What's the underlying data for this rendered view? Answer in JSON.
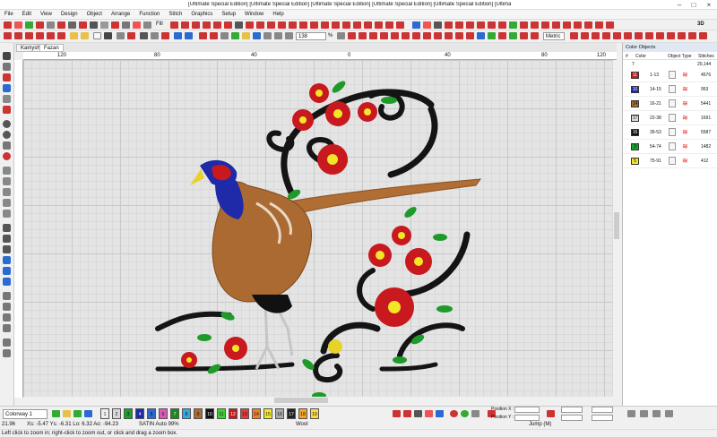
{
  "title": "[Ultimate Special Edition] [Ultimate Special Edition] [Ultimate Special Edition] [Ultimate Special Edition] [Ultimate Special Edition] [Ultimate Special Edition] [Ultimate Special Edit]",
  "menu": [
    "File",
    "Edit",
    "View",
    "Design",
    "Object",
    "Arrange",
    "Function",
    "Stitch",
    "Graphics",
    "Setup",
    "Window",
    "Help"
  ],
  "toolbar": {
    "fill_label": "Fill",
    "zoom_value": "138",
    "zoom_unit": "%",
    "metric": "Metric",
    "view3d": "3D"
  },
  "tabs": [
    "Kamysh",
    "Fazan"
  ],
  "ruler_h": [
    "120",
    "80",
    "40",
    "0",
    "40",
    "80",
    "120"
  ],
  "panel": {
    "title": "Color Objects",
    "cols": [
      "#",
      "Color",
      "Object Type",
      "Stitches"
    ],
    "summary": {
      "count": "7",
      "stitches": "20,144"
    },
    "rows": [
      {
        "num": "11",
        "color": "#c8191e",
        "range": "1-13",
        "stitches": "4576"
      },
      {
        "num": "10",
        "color": "#1a2aa8",
        "range": "14-15",
        "stitches": "953"
      },
      {
        "num": "14",
        "color": "#a96b33",
        "range": "16-21",
        "stitches": "5441"
      },
      {
        "num": "17",
        "color": "#dddddd",
        "range": "22-38",
        "stitches": "1691"
      },
      {
        "num": "16",
        "color": "#111111",
        "range": "39-53",
        "stitches": "5587"
      },
      {
        "num": "3",
        "color": "#18a02b",
        "range": "54-74",
        "stitches": "1482"
      },
      {
        "num": "5",
        "color": "#f3e626",
        "range": "75-91",
        "stitches": "412"
      }
    ]
  },
  "bottom": {
    "colorway": "Colorway 1",
    "chips": [
      "1",
      "2",
      "3",
      "4",
      "5",
      "6",
      "7",
      "8",
      "9",
      "10",
      "11",
      "12",
      "13",
      "14",
      "15",
      "16",
      "17",
      "18",
      "19"
    ],
    "pos_x_label": "Position X :",
    "pos_y_label": "Position Y :"
  },
  "status": {
    "coords": "Xs: -5.47 Ys: -6.31 Lo: 6.32 Ao: -94.23",
    "mode": "SATIN Auto 99%",
    "fabric": "Wool",
    "cmd": "Jump (M)",
    "size": "21.96",
    "hint": "Left click to zoom in; right-click to zoom out, or click and drag a zoom box."
  }
}
